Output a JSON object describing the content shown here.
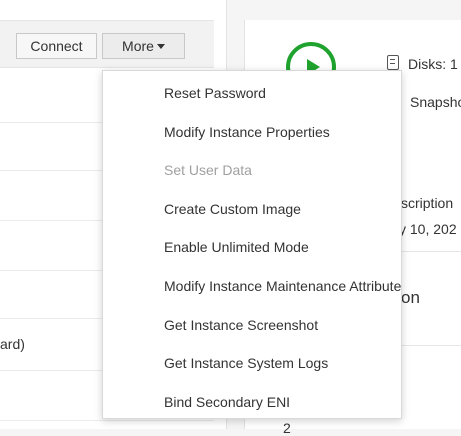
{
  "toolbar": {
    "connect_label": "Connect",
    "more_label": "More"
  },
  "left_panel": {
    "visible_row_text": "ard)"
  },
  "details": {
    "disks_label": "Disks: 1",
    "snapshots_label": "Snapsho",
    "description_label": "scription",
    "date_label": "y 10, 202",
    "section_label": "on",
    "bottom_value": "2"
  },
  "menu": {
    "items": [
      {
        "label": "Reset Password",
        "enabled": true
      },
      {
        "label": "Modify Instance Properties",
        "enabled": true
      },
      {
        "label": "Set User Data",
        "enabled": false
      },
      {
        "label": "Create Custom Image",
        "enabled": true
      },
      {
        "label": "Enable Unlimited Mode",
        "enabled": true
      },
      {
        "label": "Modify Instance Maintenance Attribute",
        "enabled": true
      },
      {
        "label": "Get Instance Screenshot",
        "enabled": true
      },
      {
        "label": "Get Instance System Logs",
        "enabled": true
      },
      {
        "label": "Bind Secondary ENI",
        "enabled": true
      }
    ]
  },
  "colors": {
    "status_green": "#1fa32e",
    "disabled_text": "#a0a0a0",
    "text": "#333333"
  }
}
